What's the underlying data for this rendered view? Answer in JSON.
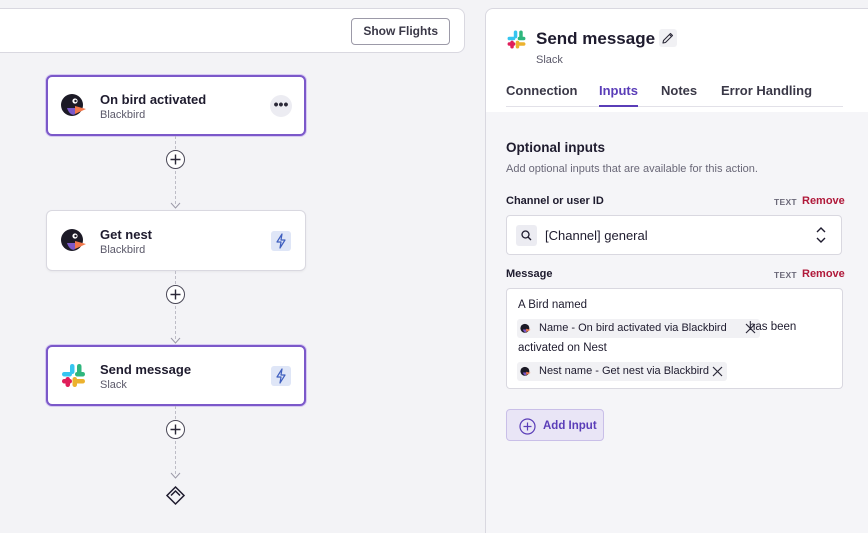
{
  "toolbar": {
    "show_flights_label": "Show Flights"
  },
  "flow": {
    "nodes": [
      {
        "title": "On bird activated",
        "app": "Blackbird",
        "icon": "blackbird-logo-icon",
        "action_icon": "more-icon"
      },
      {
        "title": "Get nest",
        "app": "Blackbird",
        "icon": "blackbird-logo-icon",
        "action_icon": "lightning-bolt-icon"
      },
      {
        "title": "Send message",
        "app": "Slack",
        "icon": "slack-logo-icon",
        "action_icon": "lightning-bolt-icon",
        "selected": true
      }
    ],
    "more_glyph": "•••"
  },
  "panel": {
    "title": "Send message",
    "app": "Slack",
    "tabs": [
      {
        "label": "Connection"
      },
      {
        "label": "Inputs",
        "active": true
      },
      {
        "label": "Notes"
      },
      {
        "label": "Error Handling"
      }
    ],
    "section": {
      "title": "Optional inputs",
      "description": "Add optional inputs that are available for this action.",
      "channel": {
        "label": "Channel or user ID",
        "type": "TEXT",
        "remove_label": "Remove",
        "value": "[Channel] general"
      },
      "message": {
        "label": "Message",
        "type": "TEXT",
        "remove_label": "Remove",
        "text_1": "A Bird named",
        "pill_1": "Name - On bird activated via Blackbird",
        "text_2": "has been",
        "text_3": "activated on Nest",
        "pill_2": "Nest name - Get nest via Blackbird"
      },
      "add_input_label": "Add Input"
    }
  },
  "colors": {
    "accent": "#5a3db8",
    "selected_border": "#7b58c9",
    "remove": "#b0193a",
    "panel_bg": "#f5f5f8"
  }
}
